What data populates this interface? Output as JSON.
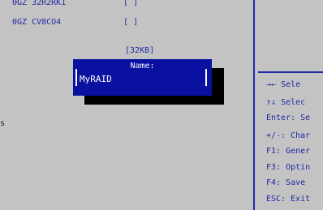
{
  "drives": [
    {
      "label": "0GZ 32R2RK1",
      "check": "[ ]"
    },
    {
      "label": "0GZ CV8CO4",
      "check": "[ ]"
    }
  ],
  "size_label": "[32KB]",
  "black_text": "s",
  "dialog": {
    "title": "Name:",
    "input_value": "MyRAID"
  },
  "help": [
    {
      "key": "→←",
      "desc": "Sele"
    },
    {
      "key": "↑↓",
      "desc": "Selec"
    },
    {
      "key": "Enter:",
      "desc": "Se"
    },
    {
      "key": "+/-:",
      "desc": "Char"
    },
    {
      "key": "F1:",
      "desc": "Gener"
    },
    {
      "key": "F3:",
      "desc": "Optin"
    },
    {
      "key": "F4:",
      "desc": "Save"
    },
    {
      "key": "ESC:",
      "desc": "Exit"
    }
  ],
  "colors": {
    "background": "#c3c3c3",
    "bios_blue": "#1f2aa6",
    "dialog_blue": "#0a10a0",
    "shadow": "#000000",
    "text_white": "#ffffff"
  }
}
